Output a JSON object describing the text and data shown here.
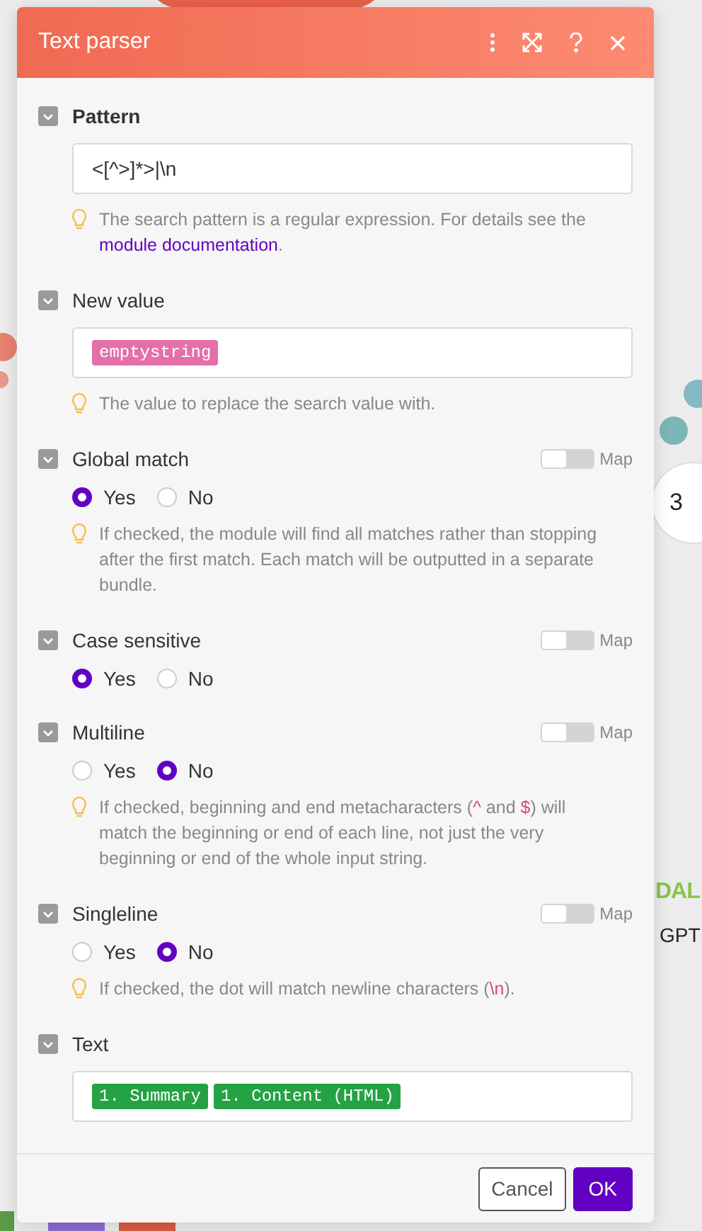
{
  "canvas": {
    "node_number": "3",
    "app_label": "DAL",
    "app_sublabel": "GPT"
  },
  "dialog": {
    "title": "Text parser",
    "fields": [
      {
        "kind": "text",
        "label": "Pattern",
        "value": "<[^>]*>|\\n",
        "hint": [
          {
            "kind": "text",
            "text": "The search pattern is a regular expression. For details see the "
          },
          {
            "kind": "link",
            "text": "module documentation"
          },
          {
            "kind": "text",
            "text": "."
          }
        ]
      },
      {
        "kind": "pill",
        "label": "New value",
        "pills": [
          {
            "text": "emptystring",
            "color": "#e56fa9"
          }
        ],
        "hint": [
          {
            "kind": "text",
            "text": "The value to replace the search value with."
          }
        ]
      },
      {
        "kind": "radio",
        "label": "Global match",
        "map": {
          "label": "Map",
          "on": false
        },
        "options": [
          {
            "label": "Yes",
            "selected": true
          },
          {
            "label": "No",
            "selected": false
          }
        ],
        "hint": [
          {
            "kind": "text",
            "text": "If checked, the module will find all matches rather than stopping after the first match. Each match will be outputted in a separate bundle."
          }
        ]
      },
      {
        "kind": "radio",
        "label": "Case sensitive",
        "map": {
          "label": "Map",
          "on": false
        },
        "options": [
          {
            "label": "Yes",
            "selected": true
          },
          {
            "label": "No",
            "selected": false
          }
        ]
      },
      {
        "kind": "radio",
        "label": "Multiline",
        "map": {
          "label": "Map",
          "on": false
        },
        "options": [
          {
            "label": "Yes",
            "selected": false
          },
          {
            "label": "No",
            "selected": true
          }
        ],
        "hint": [
          {
            "kind": "text",
            "text": "If checked, beginning and end metacharacters ("
          },
          {
            "kind": "code",
            "text": "^"
          },
          {
            "kind": "text",
            "text": " and "
          },
          {
            "kind": "code",
            "text": "$"
          },
          {
            "kind": "text",
            "text": ") will match the beginning or end of each line, not just the very beginning or end of the whole input string."
          }
        ]
      },
      {
        "kind": "radio",
        "label": "Singleline",
        "map": {
          "label": "Map",
          "on": false
        },
        "options": [
          {
            "label": "Yes",
            "selected": false
          },
          {
            "label": "No",
            "selected": true
          }
        ],
        "hint": [
          {
            "kind": "text",
            "text": "If checked, the dot will match newline characters ("
          },
          {
            "kind": "code",
            "text": "\\n"
          },
          {
            "kind": "text",
            "text": ")."
          }
        ]
      },
      {
        "kind": "pill",
        "label": "Text",
        "pills": [
          {
            "text": "1. Summary",
            "color": "#25a244"
          },
          {
            "text": "1. Content (HTML)",
            "color": "#25a244"
          }
        ]
      }
    ],
    "buttons": [
      {
        "label": "Cancel",
        "kind": "secondary"
      },
      {
        "label": "OK",
        "kind": "primary"
      }
    ]
  }
}
